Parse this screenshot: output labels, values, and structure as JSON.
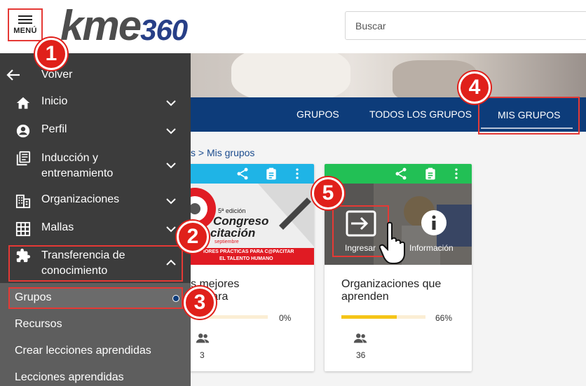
{
  "header": {
    "menu_label": "MENÚ",
    "logo_kme": "kme",
    "logo_num": "360",
    "search_placeholder": "Buscar"
  },
  "nav": {
    "tabs": [
      "GRUPOS",
      "TODOS LOS GRUPOS",
      "MIS GRUPOS"
    ],
    "active_tab": "MIS GRUPOS",
    "color": "#0d3c7a"
  },
  "breadcrumb": "s > Mis grupos",
  "sidebar": {
    "back": "Volver",
    "items": [
      {
        "label": "Inicio",
        "icon": "home-icon"
      },
      {
        "label": "Perfil",
        "icon": "account-circle-icon"
      },
      {
        "label": "Inducción y\nentrenamiento",
        "icon": "library-books-icon"
      },
      {
        "label": "Organizaciones",
        "icon": "city-icon"
      },
      {
        "label": "Mallas",
        "icon": "grid-icon"
      },
      {
        "label": "Transferencia de\nconocimiento",
        "icon": "puzzle-icon"
      }
    ],
    "subitems": [
      "Grupos",
      "Recursos",
      "Crear lecciones aprendidas",
      "Lecciones aprendidas"
    ]
  },
  "cards": [
    {
      "bar_color": "#1fb4e6",
      "image_lines": [
        "5ª edición",
        "Congreso",
        "citación",
        "septiembre",
        "IORES PRÁCTICAS PARA C@PACITAR",
        "EL TALENTO HUMANO"
      ],
      "title": "s mejores\nas para",
      "progress": 0,
      "progress_label": "0%",
      "members": "3"
    },
    {
      "bar_color": "#22c055",
      "title": "Organizaciones que\naprenden",
      "progress": 66,
      "progress_label": "66%",
      "members": "36",
      "overlay": {
        "enter": "Ingresar",
        "info": "Información"
      }
    }
  ],
  "callouts": [
    "1",
    "2",
    "3",
    "4",
    "5"
  ],
  "accent": "#e53935"
}
